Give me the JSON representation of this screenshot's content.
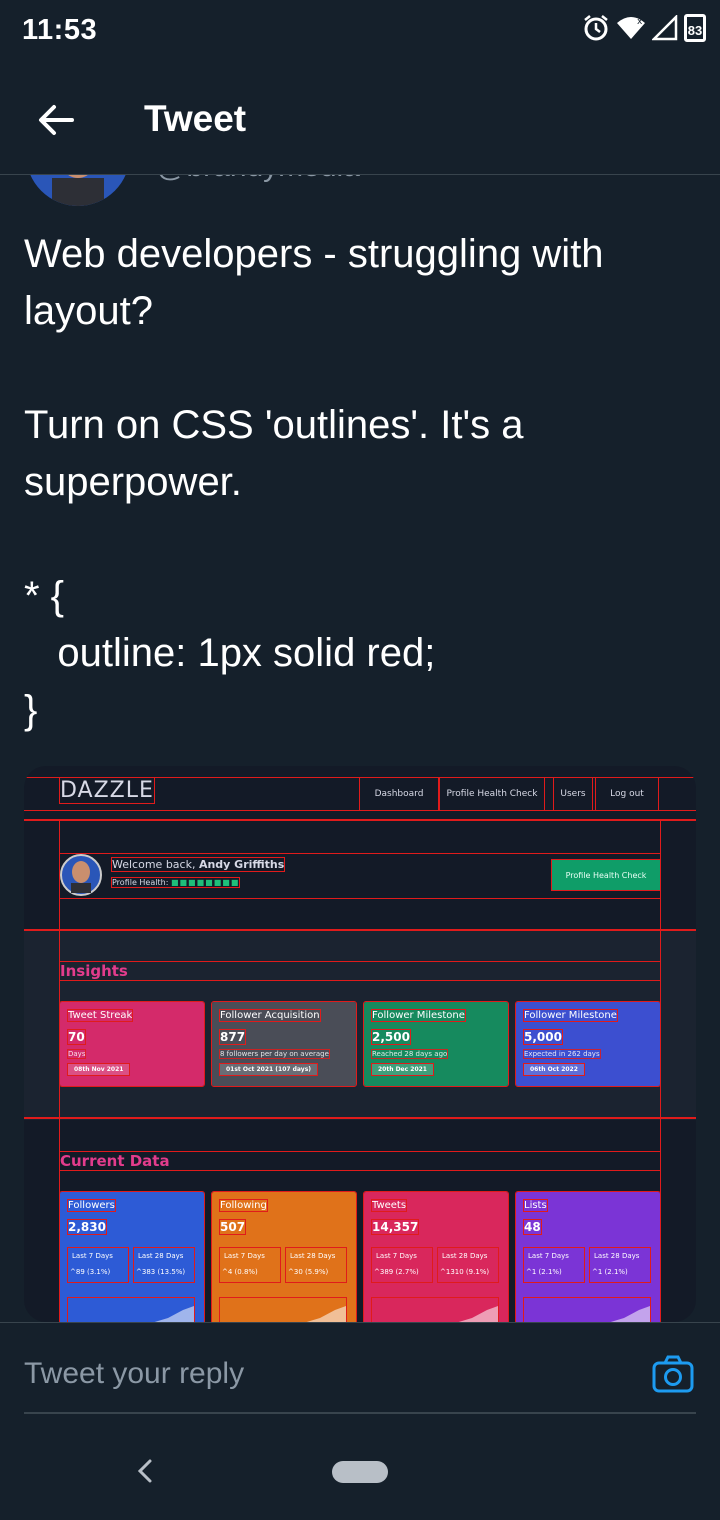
{
  "status_bar": {
    "time": "11:53",
    "battery": "83"
  },
  "header": {
    "title": "Tweet"
  },
  "author": {
    "handle": "@brandymedia"
  },
  "tweet": {
    "text": "Web developers - struggling with layout?\n\nTurn on CSS 'outlines'. It's a superpower.\n\n* {\n   outline: 1px solid red;\n}"
  },
  "screenshot": {
    "logo": "DAZZLE",
    "nav": [
      "Dashboard",
      "Profile Health Check",
      "Users",
      "Log out"
    ],
    "welcome_prefix": "Welcome back, ",
    "welcome_name": "Andy Griffiths",
    "profile_health_label": "Profile Health:",
    "profile_health_button": "Profile Health Check",
    "insights_title": "Insights",
    "insights": [
      {
        "title": "Tweet Streak",
        "value": "70",
        "sub": "Days",
        "date": "08th Nov 2021",
        "color": "#d42a6a"
      },
      {
        "title": "Follower Acquisition",
        "value": "877",
        "sub": "8 followers per day on average",
        "date": "01st Oct 2021 (107 days)",
        "color": "#4a4d57"
      },
      {
        "title": "Follower Milestone",
        "value": "2,500",
        "sub": "Reached 28 days ago",
        "date": "20th Dec 2021",
        "color": "#168a5e"
      },
      {
        "title": "Follower Milestone",
        "value": "5,000",
        "sub": "Expected in 262 days",
        "date": "06th Oct 2022",
        "color": "#3c4fd0"
      }
    ],
    "current_title": "Current Data",
    "current": [
      {
        "title": "Followers",
        "value": "2,830",
        "l7": "Last 7 Days",
        "v7": "^89 (3.1%)",
        "l28": "Last 28 Days",
        "v28": "^383 (13.5%)",
        "color": "#2d5bd6"
      },
      {
        "title": "Following",
        "value": "507",
        "l7": "Last 7 Days",
        "v7": "^4 (0.8%)",
        "l28": "Last 28 Days",
        "v28": "^30 (5.9%)",
        "color": "#e0721a"
      },
      {
        "title": "Tweets",
        "value": "14,357",
        "l7": "Last 7 Days",
        "v7": "^389 (2.7%)",
        "l28": "Last 28 Days",
        "v28": "^1310 (9.1%)",
        "color": "#d9275c"
      },
      {
        "title": "Lists",
        "value": "48",
        "l7": "Last 7 Days",
        "v7": "^1 (2.1%)",
        "l28": "Last 28 Days",
        "v28": "^1 (2.1%)",
        "color": "#7b34d6"
      }
    ]
  },
  "reply": {
    "placeholder": "Tweet your reply"
  },
  "icons": [
    "back-arrow-icon",
    "alarm-icon",
    "wifi-icon",
    "signal-icon",
    "battery-icon",
    "camera-icon",
    "nav-back-icon"
  ]
}
